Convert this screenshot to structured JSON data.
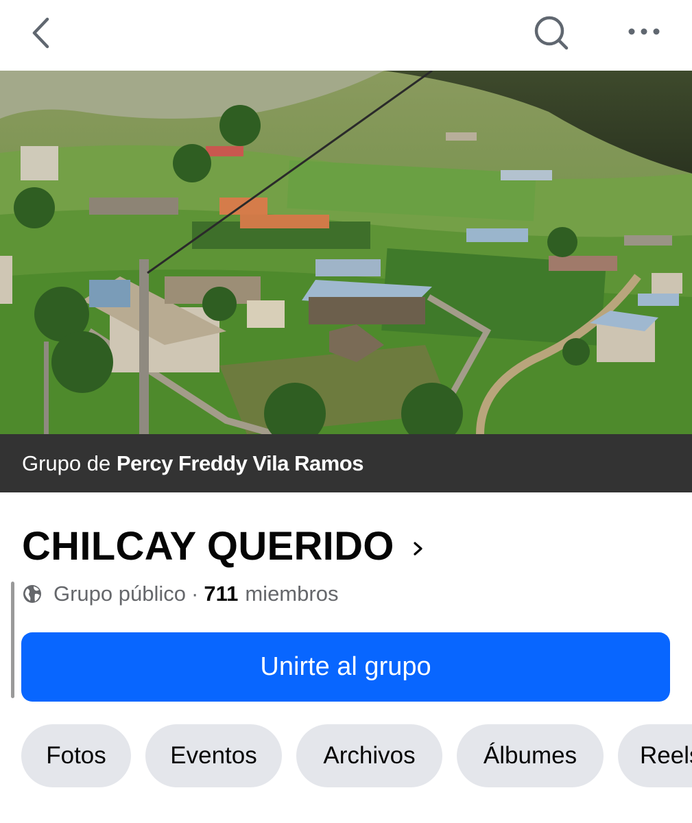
{
  "topbar": {
    "back_icon": "chevron-left-icon",
    "search_icon": "search-icon",
    "more_icon": "more-horizontal-icon"
  },
  "cover": {
    "owner_prefix": "Grupo de ",
    "owner_name": "Percy Freddy Vila Ramos"
  },
  "group": {
    "title": "CHILCAY QUERIDO",
    "privacy_icon": "globe-icon",
    "privacy": "Grupo público",
    "separator": "·",
    "member_count": "711",
    "members_label": "miembros"
  },
  "join_button": {
    "label": "Unirte al grupo",
    "color": "#0866ff"
  },
  "chips": [
    "Fotos",
    "Eventos",
    "Archivos",
    "Álbumes",
    "Reels"
  ],
  "colors": {
    "strip": "#333333",
    "chip_bg": "#e4e6eb",
    "secondary_text": "#65676b"
  }
}
